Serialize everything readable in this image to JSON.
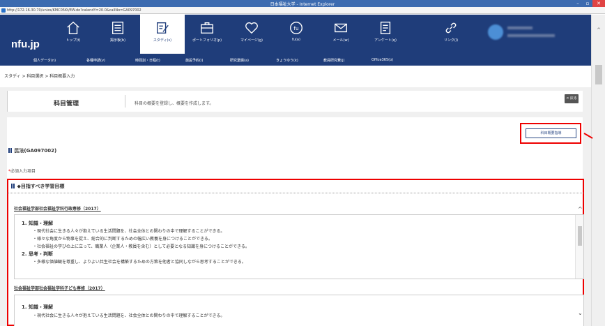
{
  "window": {
    "title": "日本福祉大学 - Internet Explorer",
    "url": "http://172.16.30.70/uniza/KMC05Kt/EW.do?calendY=20.0&callNo=GA097002"
  },
  "header": {
    "logo": "nfu.jp"
  },
  "nav": [
    {
      "label": "トップ(t)",
      "icon": "home-icon"
    },
    {
      "label": "掲示板(b)",
      "icon": "board-icon"
    },
    {
      "label": "スタディ(s)",
      "icon": "study-icon"
    },
    {
      "label": "ポートフォリオ(p)",
      "icon": "portfolio-icon"
    },
    {
      "label": "マイページ(g)",
      "icon": "heart-icon"
    },
    {
      "label": "fu(a)",
      "icon": "fu-icon"
    },
    {
      "label": "メール(w)",
      "icon": "mail-icon"
    },
    {
      "label": "アンケート(q)",
      "icon": "survey-icon"
    },
    {
      "label": "リンク(l)",
      "icon": "link-icon"
    }
  ],
  "subnav": [
    "個人データ(n)",
    "各種申請(v)",
    "時間割・日程(t)",
    "施設予約(i)",
    "研究業績(a)",
    "きょうゆう(k)",
    "教員研究費(j)",
    "Office365(o)"
  ],
  "breadcrumb": "スタディ > 科目選択 > 科目概要入力",
  "page": {
    "title": "科目管理",
    "description": "科目の概要を登録し、概要を作成します。",
    "back_label": "< 戻る",
    "syllabus_button": "科目概要指導"
  },
  "course": {
    "name": "民法(GA097002)"
  },
  "required_note": {
    "mark": "*",
    "text": "必須入力項目"
  },
  "goals": {
    "heading": "◆目指すべき学習目標",
    "programs": [
      {
        "name": "社会福祉学部社会福祉学科行政専修（2017）",
        "sections": [
          {
            "title": "1. 知識・理解",
            "items": [
              "・現代社会に生きる人々が抱えている生活問題を、社会全体との関わりの中で理解することができる。",
              "・様々な角度から物事を捉え、総合的に判断するための幅広い教養を身につけることができる。",
              "・社会福祉の学びの上に立って、職業人（企業人・教員を含む）として必要となる知識を身につけることができる。"
            ]
          },
          {
            "title": "2. 思考・判断",
            "items": [
              "・多様な価値観を尊重し、よりよい共生社会を構築するための方策を他者と協同しながら思考することができる。"
            ]
          }
        ]
      },
      {
        "name": "社会福祉学部社会福祉学科子ども専修（2017）",
        "sections": [
          {
            "title": "1. 知識・理解",
            "items": [
              "・現代社会に生きる人々が抱えている生活問題を、社会全体との関わりの中で理解することができる。"
            ]
          }
        ]
      }
    ]
  }
}
